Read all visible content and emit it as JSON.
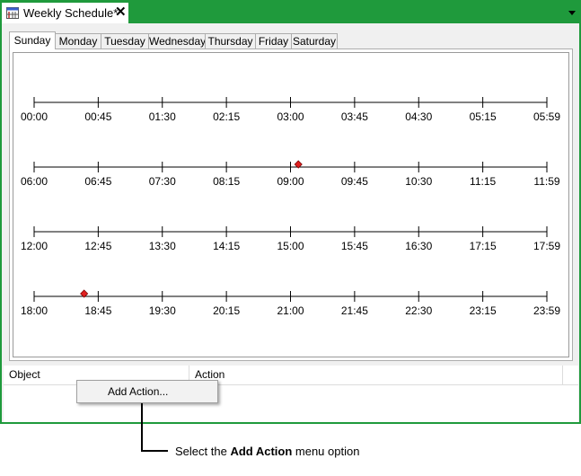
{
  "document_tab": {
    "title": "Weekly Schedule*",
    "close_label": "✕",
    "icon": "schedule-grid-icon"
  },
  "window_menu_icon": "chevron-down-icon",
  "day_tabs": [
    "Sunday",
    "Monday",
    "Tuesday",
    "Wednesday",
    "Thursday",
    "Friday",
    "Saturday"
  ],
  "selected_day": "Sunday",
  "timeline": {
    "rows": [
      [
        "00:00",
        "00:45",
        "01:30",
        "02:15",
        "03:00",
        "03:45",
        "04:30",
        "05:15",
        "05:59"
      ],
      [
        "06:00",
        "06:45",
        "07:30",
        "08:15",
        "09:00",
        "09:45",
        "10:30",
        "11:15",
        "11:59"
      ],
      [
        "12:00",
        "12:45",
        "13:30",
        "14:15",
        "15:00",
        "15:45",
        "16:30",
        "17:15",
        "17:59"
      ],
      [
        "18:00",
        "18:45",
        "19:30",
        "20:15",
        "21:00",
        "21:45",
        "22:30",
        "23:15",
        "23:59"
      ]
    ],
    "markers": [
      {
        "time": "09:05",
        "color": "#e02020"
      },
      {
        "time": "18:35",
        "color": "#e02020"
      }
    ]
  },
  "grid": {
    "columns": [
      "Object",
      "Action"
    ]
  },
  "context_menu": {
    "items": [
      "Add Action..."
    ]
  },
  "callout": {
    "prefix": "Select the ",
    "bold": "Add Action",
    "suffix": " menu option"
  }
}
